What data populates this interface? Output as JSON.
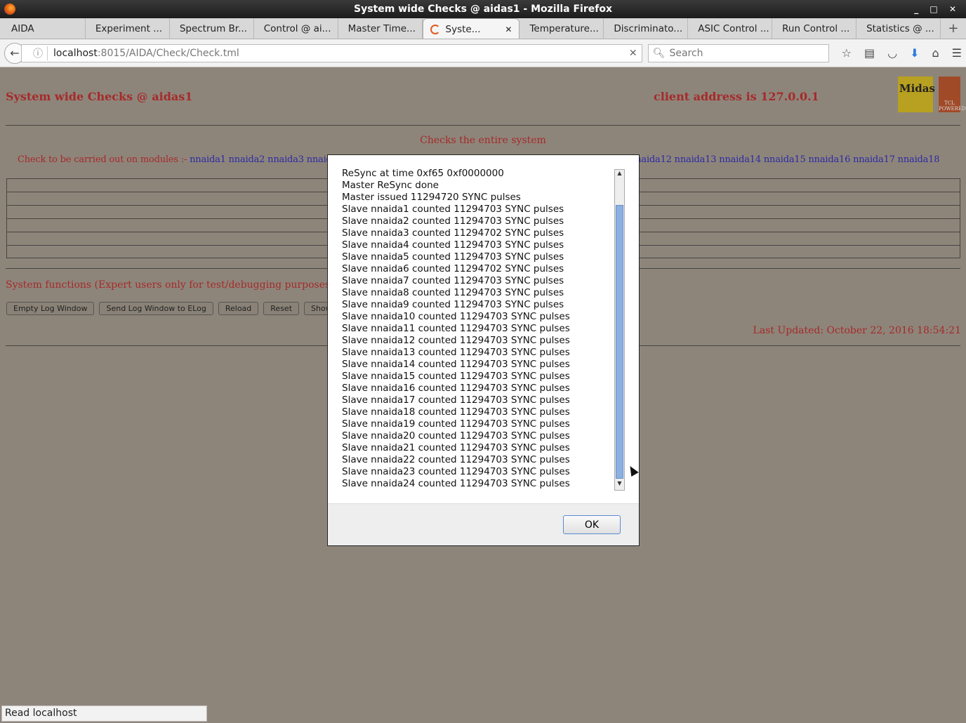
{
  "window": {
    "title": "System wide Checks @ aidas1 - Mozilla Firefox",
    "controls": "_ □ ✕"
  },
  "tabs": [
    {
      "label": "AIDA"
    },
    {
      "label": "Experiment ..."
    },
    {
      "label": "Spectrum Br..."
    },
    {
      "label": "Control @ ai..."
    },
    {
      "label": "Master Time..."
    },
    {
      "label": "Syste...",
      "active": true
    },
    {
      "label": "Temperature..."
    },
    {
      "label": "Discriminato..."
    },
    {
      "label": "ASIC Control ..."
    },
    {
      "label": "Run Control ..."
    },
    {
      "label": "Statistics @ ..."
    }
  ],
  "nav": {
    "url_host": "localhost",
    "url_path": ":8015/AIDA/Check/Check.tml",
    "search_placeholder": "Search"
  },
  "page": {
    "title": "System wide Checks @ aidas1",
    "client": "client address is 127.0.0.1",
    "subtitle": "Checks the entire system",
    "modules_label": "Check to be carried out on modules :-",
    "modules": "nnaida1 nnaida2 nnaida3 nnaida4 nnaida5 nnaida6 nnaida7 nnaida8 nnaida9 nnaida10 nnaida11 nnaida12 nnaida13 nnaida14 nnaida15 nnaida16 nnaida17 nnaida18",
    "sys_functions": "System functions (Expert users only for test/debugging purposes!!!)",
    "buttons": [
      "Empty Log Window",
      "Send Log Window to ELog",
      "Reload",
      "Reset",
      "Show"
    ],
    "updated": "Last Updated: October 22, 2016 18:54:21",
    "logo1": "Midas",
    "logo2": "TCL POWERED"
  },
  "status": "Read localhost",
  "dialog": {
    "lines": [
      "ReSync at time 0xf65 0xf0000000",
      "Master ReSync done",
      "Master issued 11294720 SYNC pulses",
      "Slave nnaida1 counted 11294703 SYNC pulses",
      "Slave nnaida2 counted 11294703 SYNC pulses",
      "Slave nnaida3 counted 11294702 SYNC pulses",
      "Slave nnaida4 counted 11294703 SYNC pulses",
      "Slave nnaida5 counted 11294703 SYNC pulses",
      "Slave nnaida6 counted 11294702 SYNC pulses",
      "Slave nnaida7 counted 11294703 SYNC pulses",
      "Slave nnaida8 counted 11294703 SYNC pulses",
      "Slave nnaida9 counted 11294703 SYNC pulses",
      "Slave nnaida10 counted 11294703 SYNC pulses",
      "Slave nnaida11 counted 11294703 SYNC pulses",
      "Slave nnaida12 counted 11294703 SYNC pulses",
      "Slave nnaida13 counted 11294703 SYNC pulses",
      "Slave nnaida14 counted 11294703 SYNC pulses",
      "Slave nnaida15 counted 11294703 SYNC pulses",
      "Slave nnaida16 counted 11294703 SYNC pulses",
      "Slave nnaida17 counted 11294703 SYNC pulses",
      "Slave nnaida18 counted 11294703 SYNC pulses",
      "Slave nnaida19 counted 11294703 SYNC pulses",
      "Slave nnaida20 counted 11294703 SYNC pulses",
      "Slave nnaida21 counted 11294703 SYNC pulses",
      "Slave nnaida22 counted 11294703 SYNC pulses",
      "Slave nnaida23 counted 11294703 SYNC pulses",
      "Slave nnaida24 counted 11294703 SYNC pulses"
    ],
    "ok": "OK"
  }
}
